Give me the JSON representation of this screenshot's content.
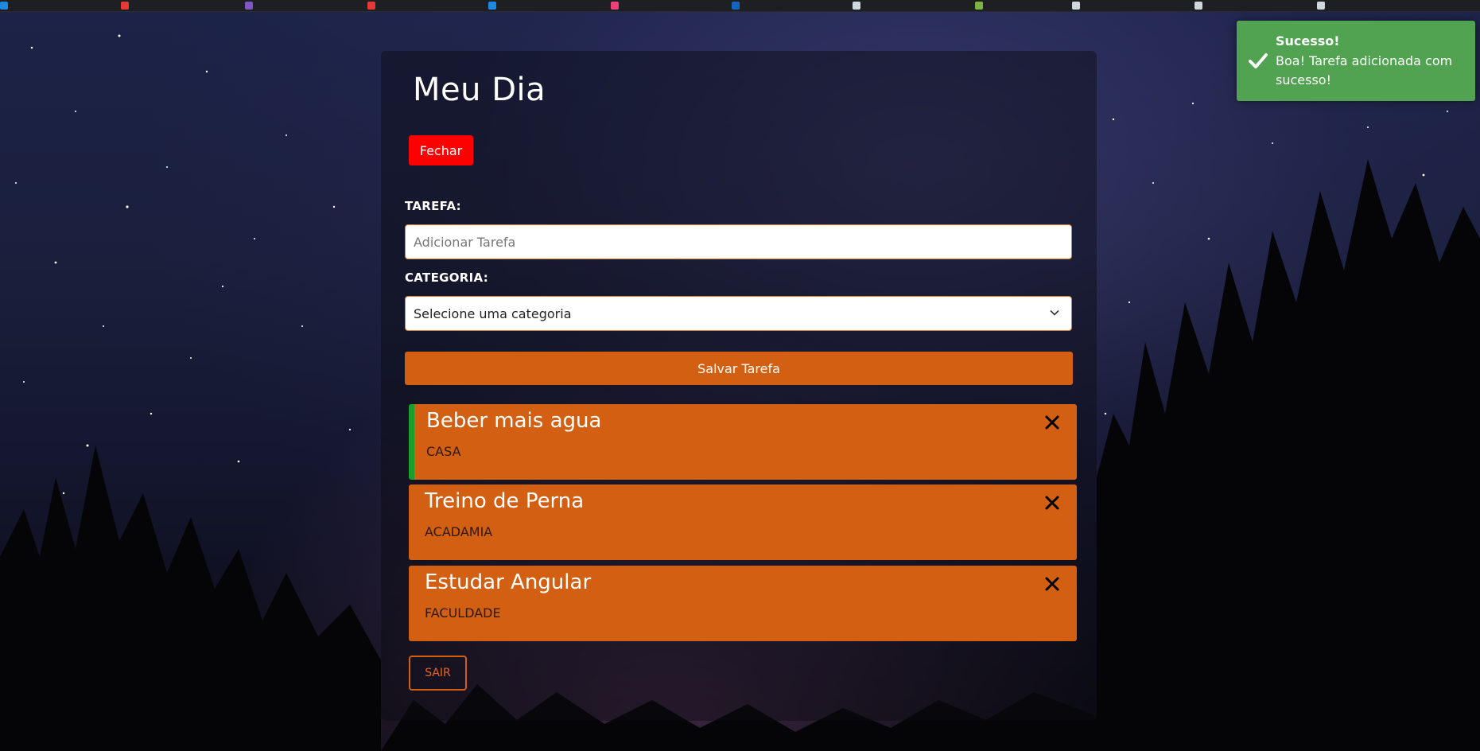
{
  "colors": {
    "accent": "#d35f12",
    "danger": "#ff0000",
    "success": "#51a351",
    "done_marker": "#1aa02a"
  },
  "app": {
    "title": "Meu Dia",
    "close_label": "Fechar"
  },
  "form": {
    "task_label": "TAREFA:",
    "task_placeholder": "Adicionar Tarefa",
    "task_value": "",
    "category_label": "CATEGORIA:",
    "category_selected": "Selecione uma categoria",
    "save_label": "Salvar Tarefa"
  },
  "tasks": [
    {
      "title": "Beber mais agua",
      "category": "CASA",
      "done": true
    },
    {
      "title": "Treino de Perna",
      "category": "ACADAMIA",
      "done": false
    },
    {
      "title": "Estudar Angular",
      "category": "FACULDADE",
      "done": false
    }
  ],
  "logout_label": "SAIR",
  "toast": {
    "title": "Sucesso!",
    "message": "Boa! Tarefa adicionada com sucesso!",
    "icon": "check-icon"
  }
}
